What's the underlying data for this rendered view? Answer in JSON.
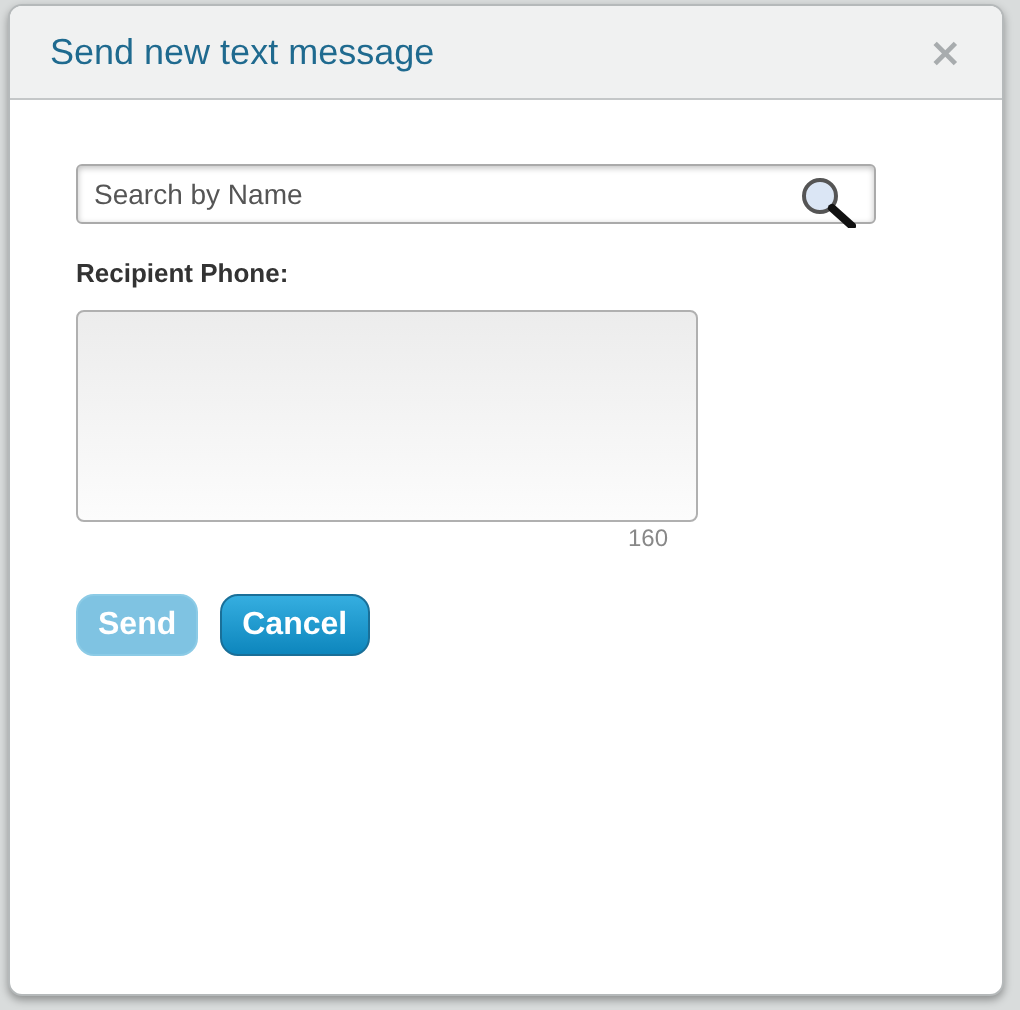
{
  "dialog": {
    "title": "Send new text message",
    "close": "×"
  },
  "search": {
    "placeholder": "Search by Name"
  },
  "recipient_label": "Recipient Phone:",
  "message": {
    "counter": "160"
  },
  "buttons": [
    {
      "label": "Send",
      "disabled": true
    },
    {
      "label": "Cancel",
      "disabled": false
    }
  ]
}
